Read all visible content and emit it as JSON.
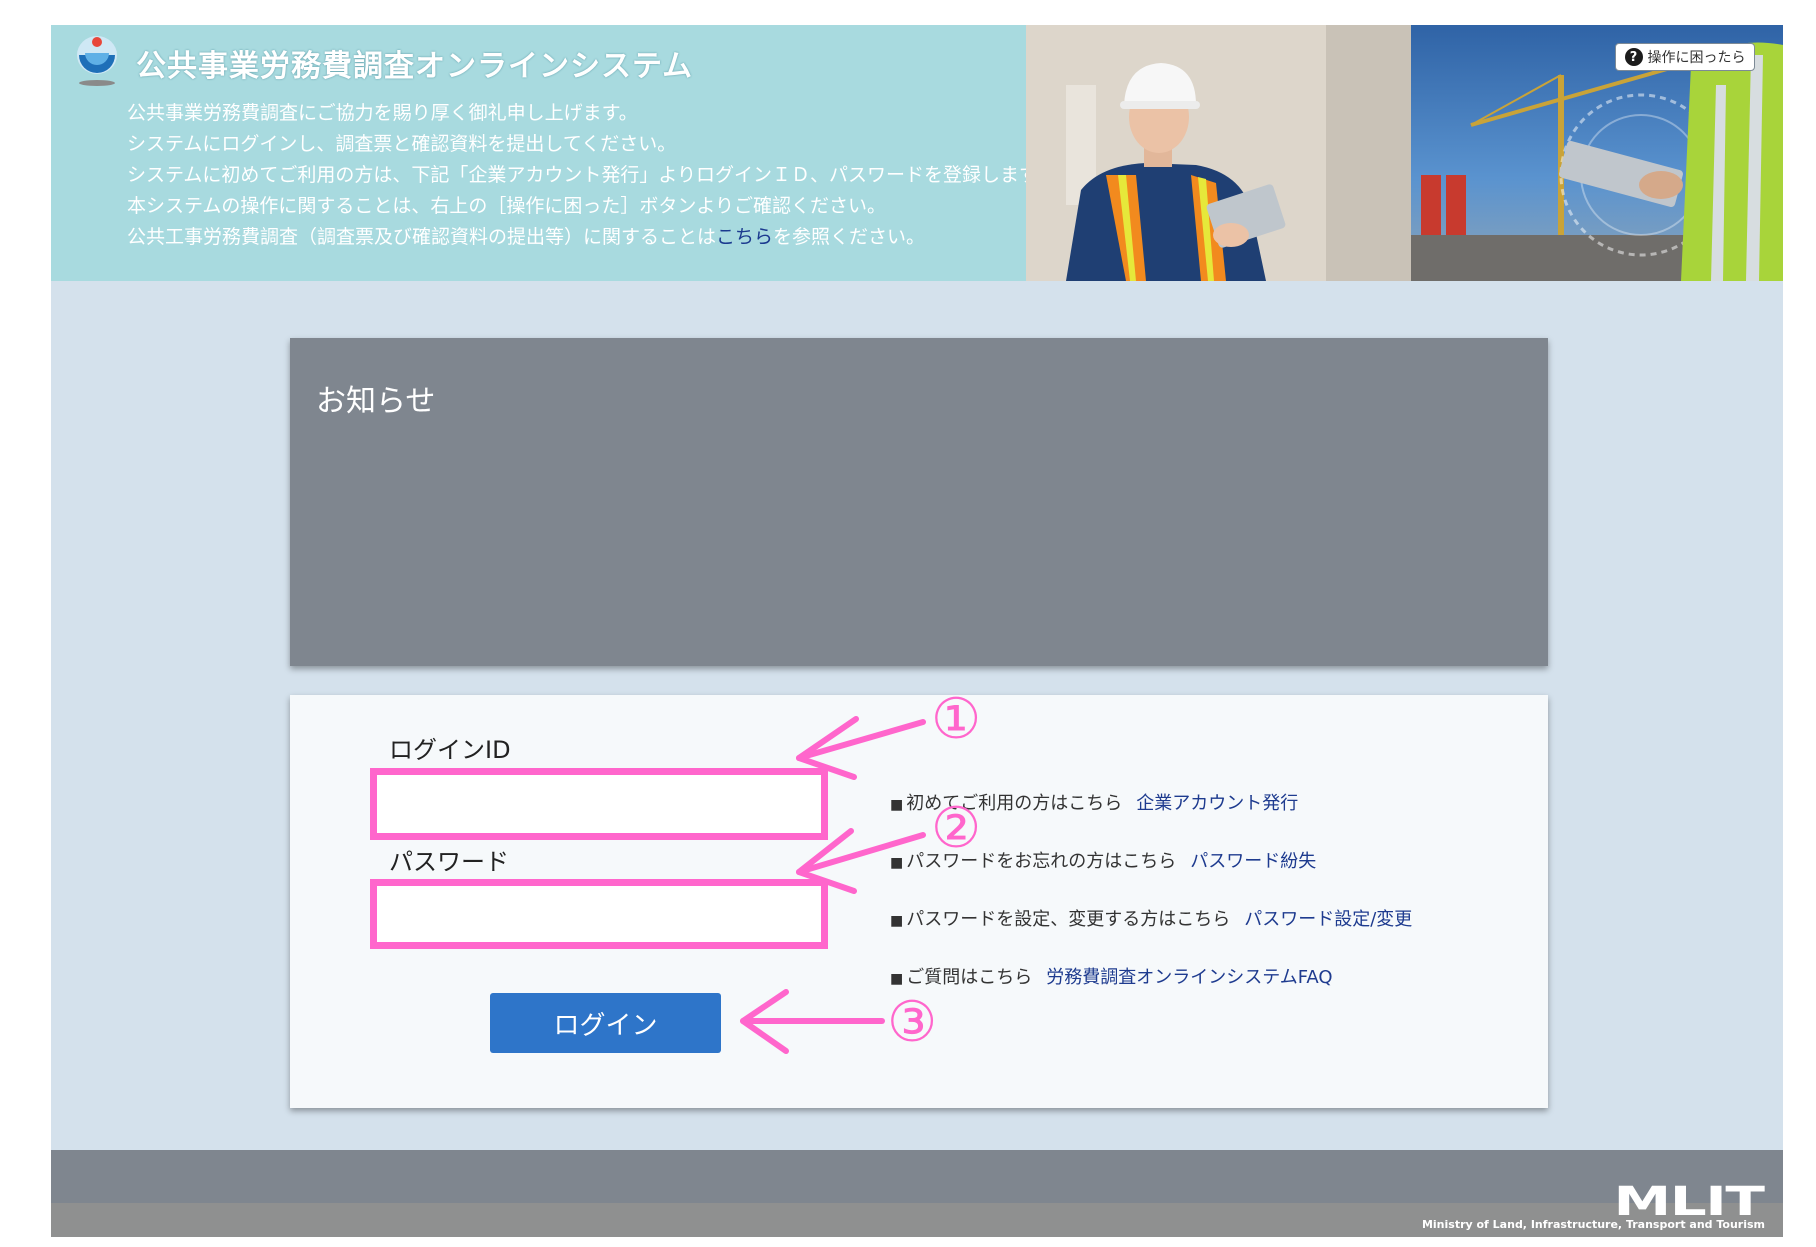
{
  "header": {
    "title": "公共事業労務費調査オンラインシステム",
    "intro_lines": [
      "公共事業労務費調査にご協力を賜り厚く御礼申し上げます。",
      "システムにログインし、調査票と確認資料を提出してください。",
      "システムに初めてご利用の方は、下記「企業アカウント発行」よりログインＩＤ、パスワードを登録します。",
      "本システムの操作に関することは、右上の［操作に困った］ボタンよりご確認ください。"
    ],
    "intro_last_before": "公共工事労務費調査（調査票及び確認資料の提出等）に関することは",
    "intro_last_link": "こちら",
    "intro_last_after": "を参照ください。",
    "help_button_label": "操作に困ったら"
  },
  "notice": {
    "title": "お知らせ"
  },
  "login": {
    "id_label": "ログインID",
    "password_label": "パスワード",
    "id_value": "",
    "password_value": "",
    "button_label": "ログイン"
  },
  "links": [
    {
      "text": "初めてご利用の方はこちら",
      "link": "企業アカウント発行"
    },
    {
      "text": "パスワードをお忘れの方はこちら",
      "link": "パスワード紛失"
    },
    {
      "text": "パスワードを設定、変更する方はこちら",
      "link": "パスワード設定/変更"
    },
    {
      "text": "ご質問はこちら",
      "link": "労務費調査オンラインシステムFAQ"
    }
  ],
  "link_bullet": "■",
  "annotations": {
    "marker1": "①",
    "marker2": "②",
    "marker3": "③",
    "color": "#ff66cc"
  },
  "footer": {
    "logo_text": "MLIT",
    "subtitle": "Ministry of Land, Infrastructure, Transport and Tourism"
  }
}
